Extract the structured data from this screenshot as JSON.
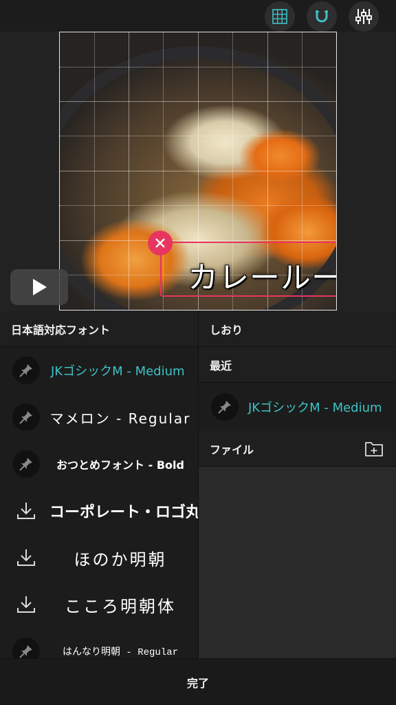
{
  "toolbar": {
    "icons": [
      "grid-icon",
      "magnet-icon",
      "sliders-icon"
    ],
    "accent_color": "#3fc2c6"
  },
  "canvas": {
    "text_overlay": "カレールー",
    "selection_color": "#e8355f"
  },
  "left_panel": {
    "title": "日本語対応フォント",
    "fonts": [
      {
        "name": "JKゴシックM - Medium",
        "icon": "pin-icon",
        "active": true
      },
      {
        "name": "マメロン - Regular",
        "icon": "pin-icon",
        "active": false
      },
      {
        "name": "おつとめフォント - Bold",
        "icon": "pin-icon",
        "active": false
      },
      {
        "name": "コーポレート・ロゴ丸",
        "icon": "download-icon",
        "active": false
      },
      {
        "name": "ほのか明朝",
        "icon": "download-icon",
        "active": false
      },
      {
        "name": "こころ明朝体",
        "icon": "download-icon",
        "active": false
      },
      {
        "name": "はんなり明朝 - Regular",
        "icon": "pin-icon",
        "active": false
      }
    ]
  },
  "right_panel": {
    "bookmarks_label": "しおり",
    "recent_label": "最近",
    "recent_font": "JKゴシックM - Medium",
    "files_label": "ファイル"
  },
  "footer": {
    "done_label": "完了"
  }
}
